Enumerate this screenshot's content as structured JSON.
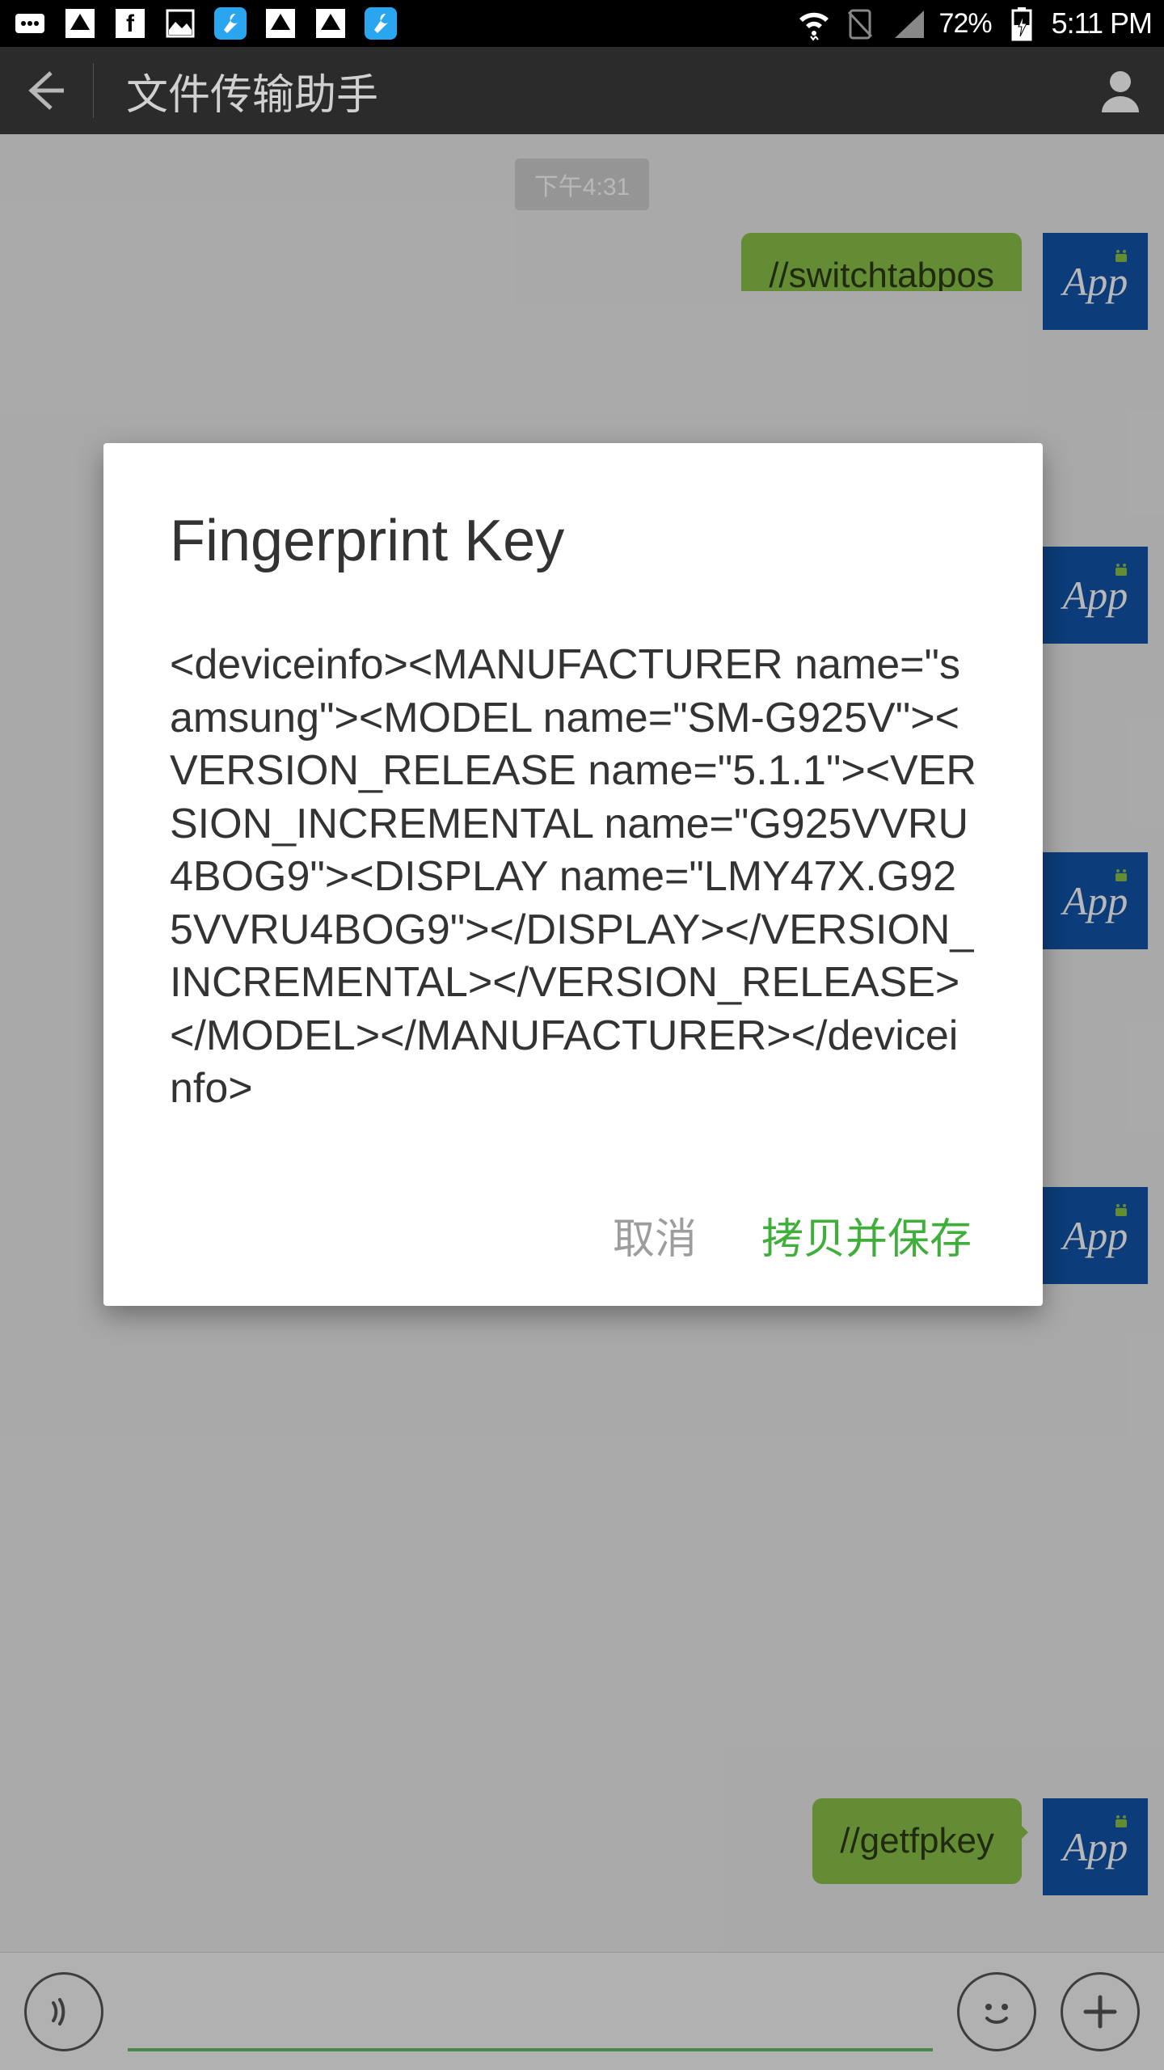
{
  "status_bar": {
    "battery_pct": "72%",
    "clock": "5:11 PM"
  },
  "app_bar": {
    "title": "文件传输助手"
  },
  "chat": {
    "time_pill": "下午4:31",
    "messages": [
      {
        "text": "//switchtabpos",
        "avatar": "App"
      },
      {
        "text": "",
        "avatar": "App"
      },
      {
        "text": "",
        "avatar": "App"
      },
      {
        "text": "",
        "avatar": "App"
      },
      {
        "text": "//getfpkey",
        "avatar": "App"
      }
    ]
  },
  "input_bar": {
    "placeholder": ""
  },
  "dialog": {
    "title": "Fingerprint Key",
    "body": "<deviceinfo><MANUFACTURER name=\"samsung\"><MODEL name=\"SM-G925V\"><VERSION_RELEASE name=\"5.1.1\"><VERSION_INCREMENTAL name=\"G925VVRU4BOG9\"><DISPLAY name=\"LMY47X.G925VVRU4BOG9\"></DISPLAY></VERSION_INCREMENTAL></VERSION_RELEASE></MODEL></MANUFACTURER></deviceinfo>",
    "cancel_label": "取消",
    "confirm_label": "拷贝并保存"
  }
}
